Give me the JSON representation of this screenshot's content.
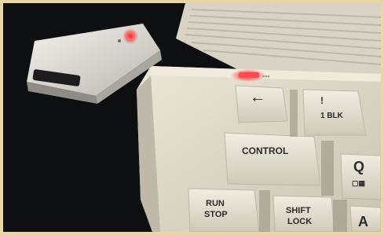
{
  "scene": {
    "description_tag": "photo",
    "colors": {
      "border": "#e8d6a4",
      "background": "#0e0f11",
      "case_beige": "#d9d3c3",
      "key_beige": "#e6e1d3",
      "led_red": "#ff3b3b"
    }
  },
  "dongle": {
    "led_color": "#ff3b3b"
  },
  "keyboard": {
    "power_led_color": "#ff4a55",
    "keys": {
      "arrow_left": "←",
      "blk_top": "!",
      "blk_bottom": "1 BLK",
      "control": "CONTROL",
      "q": "Q",
      "run_stop_line1": "RUN",
      "run_stop_line2": "STOP",
      "shift_lock_line1": "SHIFT",
      "shift_lock_line2": "LOCK",
      "a": "A"
    }
  }
}
